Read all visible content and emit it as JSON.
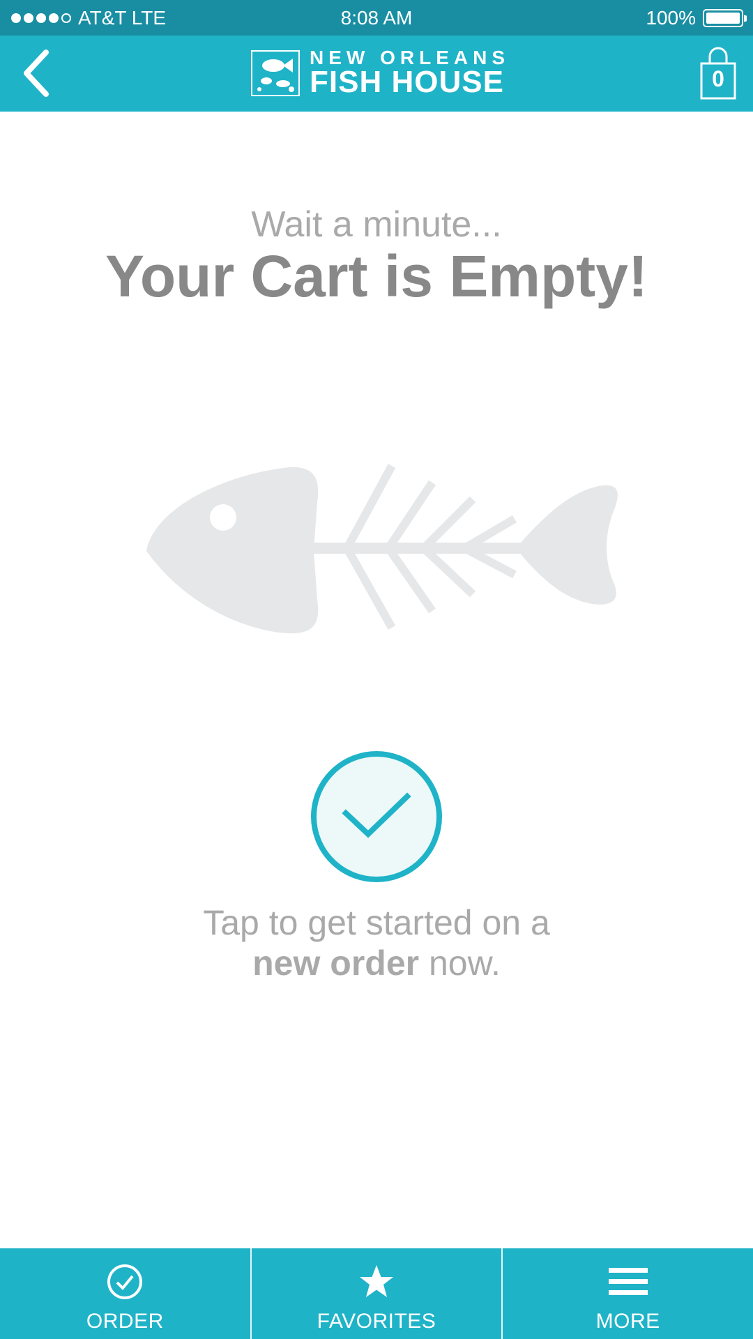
{
  "status_bar": {
    "carrier": "AT&T LTE",
    "time": "8:08 AM",
    "battery": "100%",
    "battery_level": 1.0,
    "signal_bars": 4
  },
  "header": {
    "back_icon": "chevron-left-icon",
    "logo": {
      "line1": "NEW ORLEANS",
      "line2": "FISH HOUSE"
    },
    "cart_icon": "shopping-bag-icon",
    "cart_count": "0"
  },
  "main": {
    "subtitle": "Wait a minute...",
    "title": "Your Cart is Empty!",
    "illustration": "fish-skeleton-icon",
    "cta_icon": "checkmark-icon",
    "cta_line1": "Tap to get started on a",
    "cta_bold": "new order",
    "cta_rest": " now."
  },
  "tabs": [
    {
      "label": "ORDER",
      "icon": "check-circle-icon"
    },
    {
      "label": "FAVORITES",
      "icon": "star-icon"
    },
    {
      "label": "MORE",
      "icon": "menu-icon"
    }
  ],
  "colors": {
    "status_bar": "#198ea3",
    "primary": "#1fb3c8",
    "text_light": "#a9a9a9",
    "text_dark": "#888888",
    "illustration": "#e6e7e8"
  }
}
